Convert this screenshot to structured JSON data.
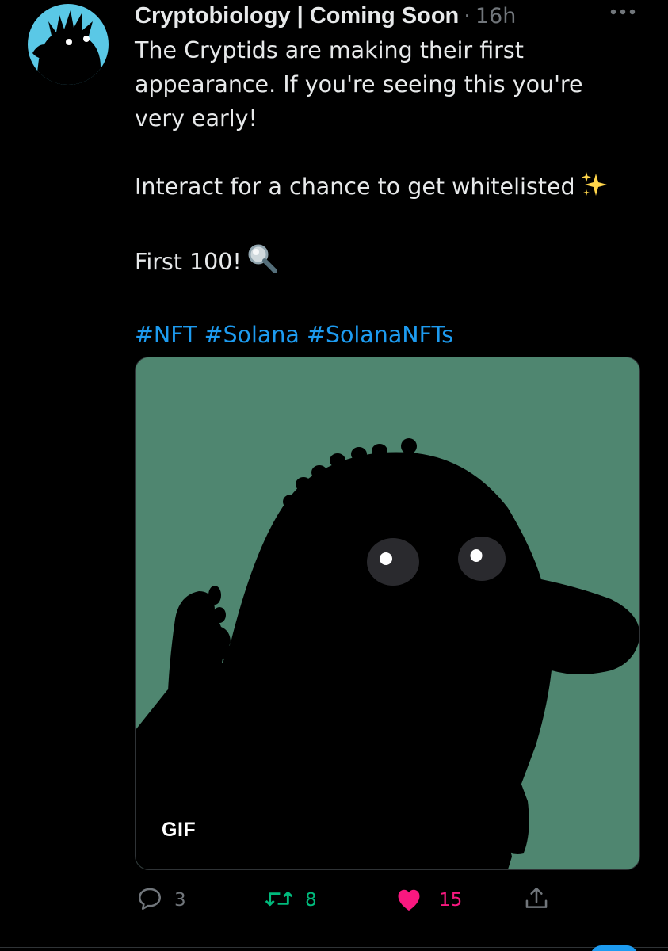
{
  "tweet": {
    "author": "Cryptobiology | Coming Soon",
    "separator": "·",
    "time": "16h",
    "line1": "The Cryptids are making their first",
    "line2": "appearance. If you're seeing this you're",
    "line3": "very early!",
    "line4": "Interact for a chance to get whitelisted",
    "line5": "First 100!",
    "hashtags": [
      "#NFT",
      "#Solana",
      "#SolanaNFTs"
    ]
  },
  "media": {
    "badge": "GIF",
    "background_color": "#4f8670"
  },
  "actions": {
    "reply_count": "3",
    "retweet_count": "8",
    "like_count": "15"
  },
  "icons": {
    "avatar": "cryptid-avatar",
    "more": "more-dots-icon",
    "sparkles": "sparkles-emoji",
    "magnifier": "magnifying-glass-emoji",
    "reply": "reply-icon",
    "retweet": "retweet-icon",
    "like": "heart-icon",
    "share": "share-icon"
  },
  "colors": {
    "link": "#1d9bf0",
    "retweet": "#00ba7c",
    "like": "#f91880",
    "secondary": "#71767b"
  }
}
